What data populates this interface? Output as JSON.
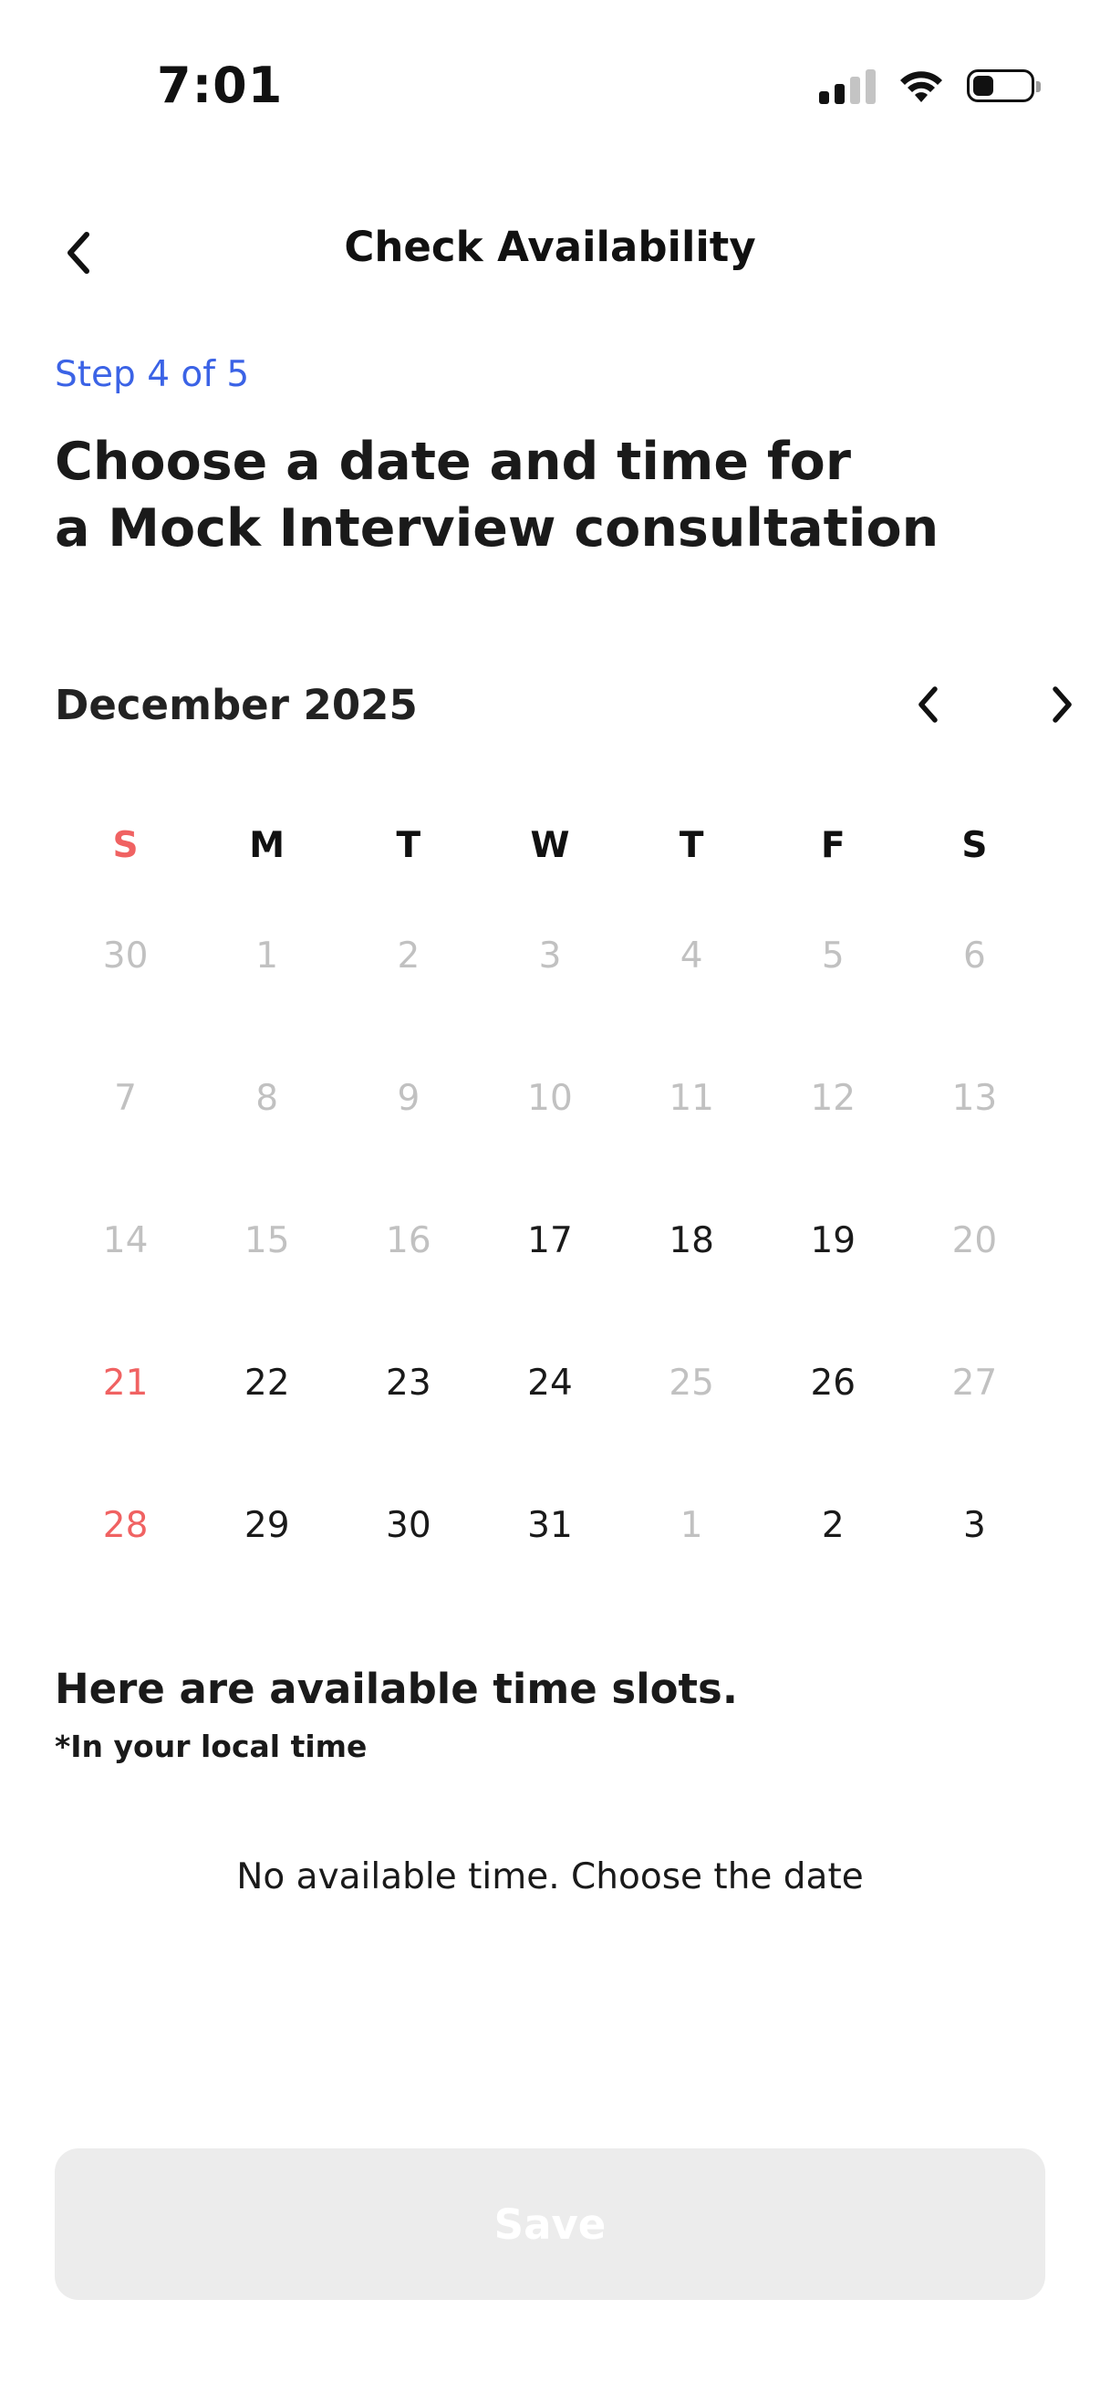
{
  "status_bar": {
    "time": "7:01",
    "icons": [
      "cellular-signal-icon",
      "wifi-icon",
      "battery-icon"
    ]
  },
  "nav": {
    "title": "Check Availability",
    "back_icon": "chevron-left-icon"
  },
  "step": {
    "label": "Step 4 of 5"
  },
  "heading": {
    "line1": "Choose a date and time for",
    "line2": "a Mock Interview consultation"
  },
  "calendar": {
    "month_label": "December 2025",
    "prev_icon": "chevron-left-icon",
    "next_icon": "chevron-right-icon",
    "weekdays": [
      "S",
      "M",
      "T",
      "W",
      "T",
      "F",
      "S"
    ],
    "weeks": [
      [
        {
          "label": "30",
          "state": "disabled"
        },
        {
          "label": "1",
          "state": "disabled"
        },
        {
          "label": "2",
          "state": "disabled"
        },
        {
          "label": "3",
          "state": "disabled"
        },
        {
          "label": "4",
          "state": "disabled"
        },
        {
          "label": "5",
          "state": "disabled"
        },
        {
          "label": "6",
          "state": "disabled"
        }
      ],
      [
        {
          "label": "7",
          "state": "disabled"
        },
        {
          "label": "8",
          "state": "disabled"
        },
        {
          "label": "9",
          "state": "disabled"
        },
        {
          "label": "10",
          "state": "disabled"
        },
        {
          "label": "11",
          "state": "disabled"
        },
        {
          "label": "12",
          "state": "disabled"
        },
        {
          "label": "13",
          "state": "disabled"
        }
      ],
      [
        {
          "label": "14",
          "state": "disabled"
        },
        {
          "label": "15",
          "state": "disabled"
        },
        {
          "label": "16",
          "state": "disabled"
        },
        {
          "label": "17",
          "state": "available"
        },
        {
          "label": "18",
          "state": "available"
        },
        {
          "label": "19",
          "state": "available"
        },
        {
          "label": "20",
          "state": "disabled"
        }
      ],
      [
        {
          "label": "21",
          "state": "sunday"
        },
        {
          "label": "22",
          "state": "available"
        },
        {
          "label": "23",
          "state": "available"
        },
        {
          "label": "24",
          "state": "available"
        },
        {
          "label": "25",
          "state": "disabled"
        },
        {
          "label": "26",
          "state": "available"
        },
        {
          "label": "27",
          "state": "disabled"
        }
      ],
      [
        {
          "label": "28",
          "state": "sunday"
        },
        {
          "label": "29",
          "state": "available"
        },
        {
          "label": "30",
          "state": "available"
        },
        {
          "label": "31",
          "state": "available"
        },
        {
          "label": "1",
          "state": "disabled"
        },
        {
          "label": "2",
          "state": "available"
        },
        {
          "label": "3",
          "state": "available"
        }
      ]
    ]
  },
  "slots": {
    "heading": "Here are available time slots.",
    "note": "*In your local time",
    "empty_message": "No available time. Choose the date"
  },
  "actions": {
    "save_label": "Save"
  },
  "colors": {
    "accent": "#3b63e6",
    "sunday": "#f06262",
    "disabled_text": "#c1c1c1",
    "button_disabled_bg": "#ececec"
  }
}
